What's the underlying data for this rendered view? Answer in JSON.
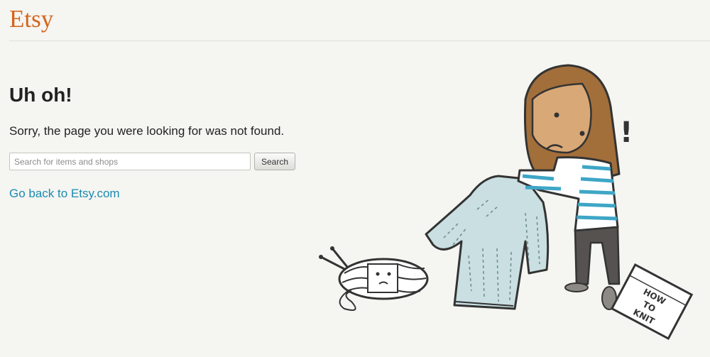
{
  "header": {
    "logo_text": "Etsy"
  },
  "main": {
    "heading": "Uh oh!",
    "message": "Sorry, the page you were looking for was not found.",
    "search": {
      "placeholder": "Search for items and shops",
      "value": "",
      "button_label": "Search"
    },
    "back_link": "Go back to Etsy.com"
  },
  "illustration": {
    "exclamation": "!",
    "booklet_lines": [
      "HOW",
      "TO",
      "KNIT"
    ]
  },
  "colors": {
    "brand": "#d5641c",
    "link": "#1a8bb3",
    "background": "#f5f5f1",
    "sweater": "#c9dfe2",
    "hair": "#a26e3a",
    "skin": "#d9a877",
    "stripe": "#3ea6c6"
  }
}
